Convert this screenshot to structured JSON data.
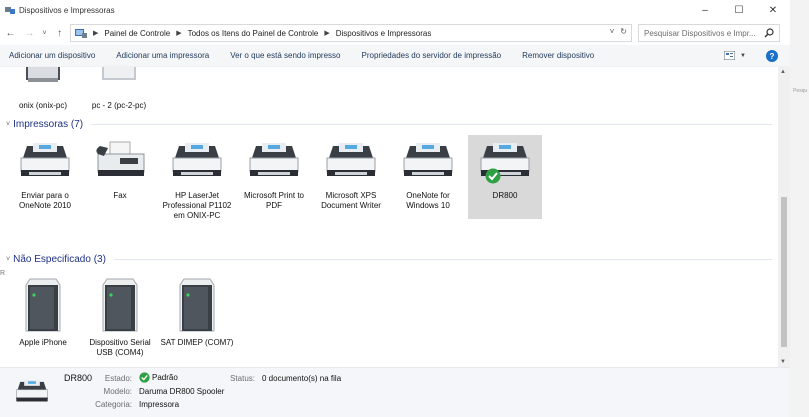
{
  "window": {
    "title": "Dispositivos e Impressoras",
    "controls": [
      "minimize",
      "maximize",
      "close"
    ]
  },
  "address": {
    "breadcrumbs": [
      "Painel de Controle",
      "Todos os Itens do Painel de Controle",
      "Dispositivos e Impressoras"
    ],
    "search_placeholder": "Pesquisar Dispositivos e Impr..."
  },
  "toolbar": {
    "commands": [
      "Adicionar um dispositivo",
      "Adicionar uma impressora",
      "Ver o que está sendo impresso",
      "Propriedades do servidor de impressão",
      "Remover dispositivo"
    ]
  },
  "groups": {
    "devices_partial": [
      {
        "label": "onix (onix-pc)"
      },
      {
        "label": "pc - 2 (pc-2-pc)"
      }
    ],
    "printers": {
      "header": "Impressoras (7)",
      "items": [
        {
          "label": "Enviar para o OneNote 2010",
          "icon": "printer-icon"
        },
        {
          "label": "Fax",
          "icon": "fax-icon"
        },
        {
          "label": "HP LaserJet Professional P1102 em ONIX-PC",
          "icon": "printer-icon"
        },
        {
          "label": "Microsoft Print to PDF",
          "icon": "printer-icon"
        },
        {
          "label": "Microsoft XPS Document Writer",
          "icon": "printer-icon"
        },
        {
          "label": "OneNote for Windows 10",
          "icon": "printer-icon"
        },
        {
          "label": "DR800",
          "icon": "printer-icon",
          "default": true,
          "selected": true
        }
      ]
    },
    "unspecified": {
      "header": "Não Especificado (3)",
      "items": [
        {
          "label": "Apple iPhone",
          "icon": "tower-icon"
        },
        {
          "label": "Dispositivo Serial USB (COM4)",
          "icon": "tower-icon"
        },
        {
          "label": "SAT DIMEP (COM7)",
          "icon": "tower-icon"
        }
      ]
    }
  },
  "details": {
    "name": "DR800",
    "estado_label": "Estado:",
    "estado_value": "Padrão",
    "status_label": "Status:",
    "status_value": "0 documento(s) na fila",
    "modelo_label": "Modelo:",
    "modelo_value": "Daruma DR800 Spooler",
    "categoria_label": "Categoria:",
    "categoria_value": "Impressora"
  },
  "colors": {
    "group_header": "#1e3287",
    "selected_tile": "#d9d9d9",
    "default_check": "#2ea043",
    "command_text": "#1e395b"
  },
  "edge_text": {
    "right": "Pesqu",
    "left": "R"
  }
}
